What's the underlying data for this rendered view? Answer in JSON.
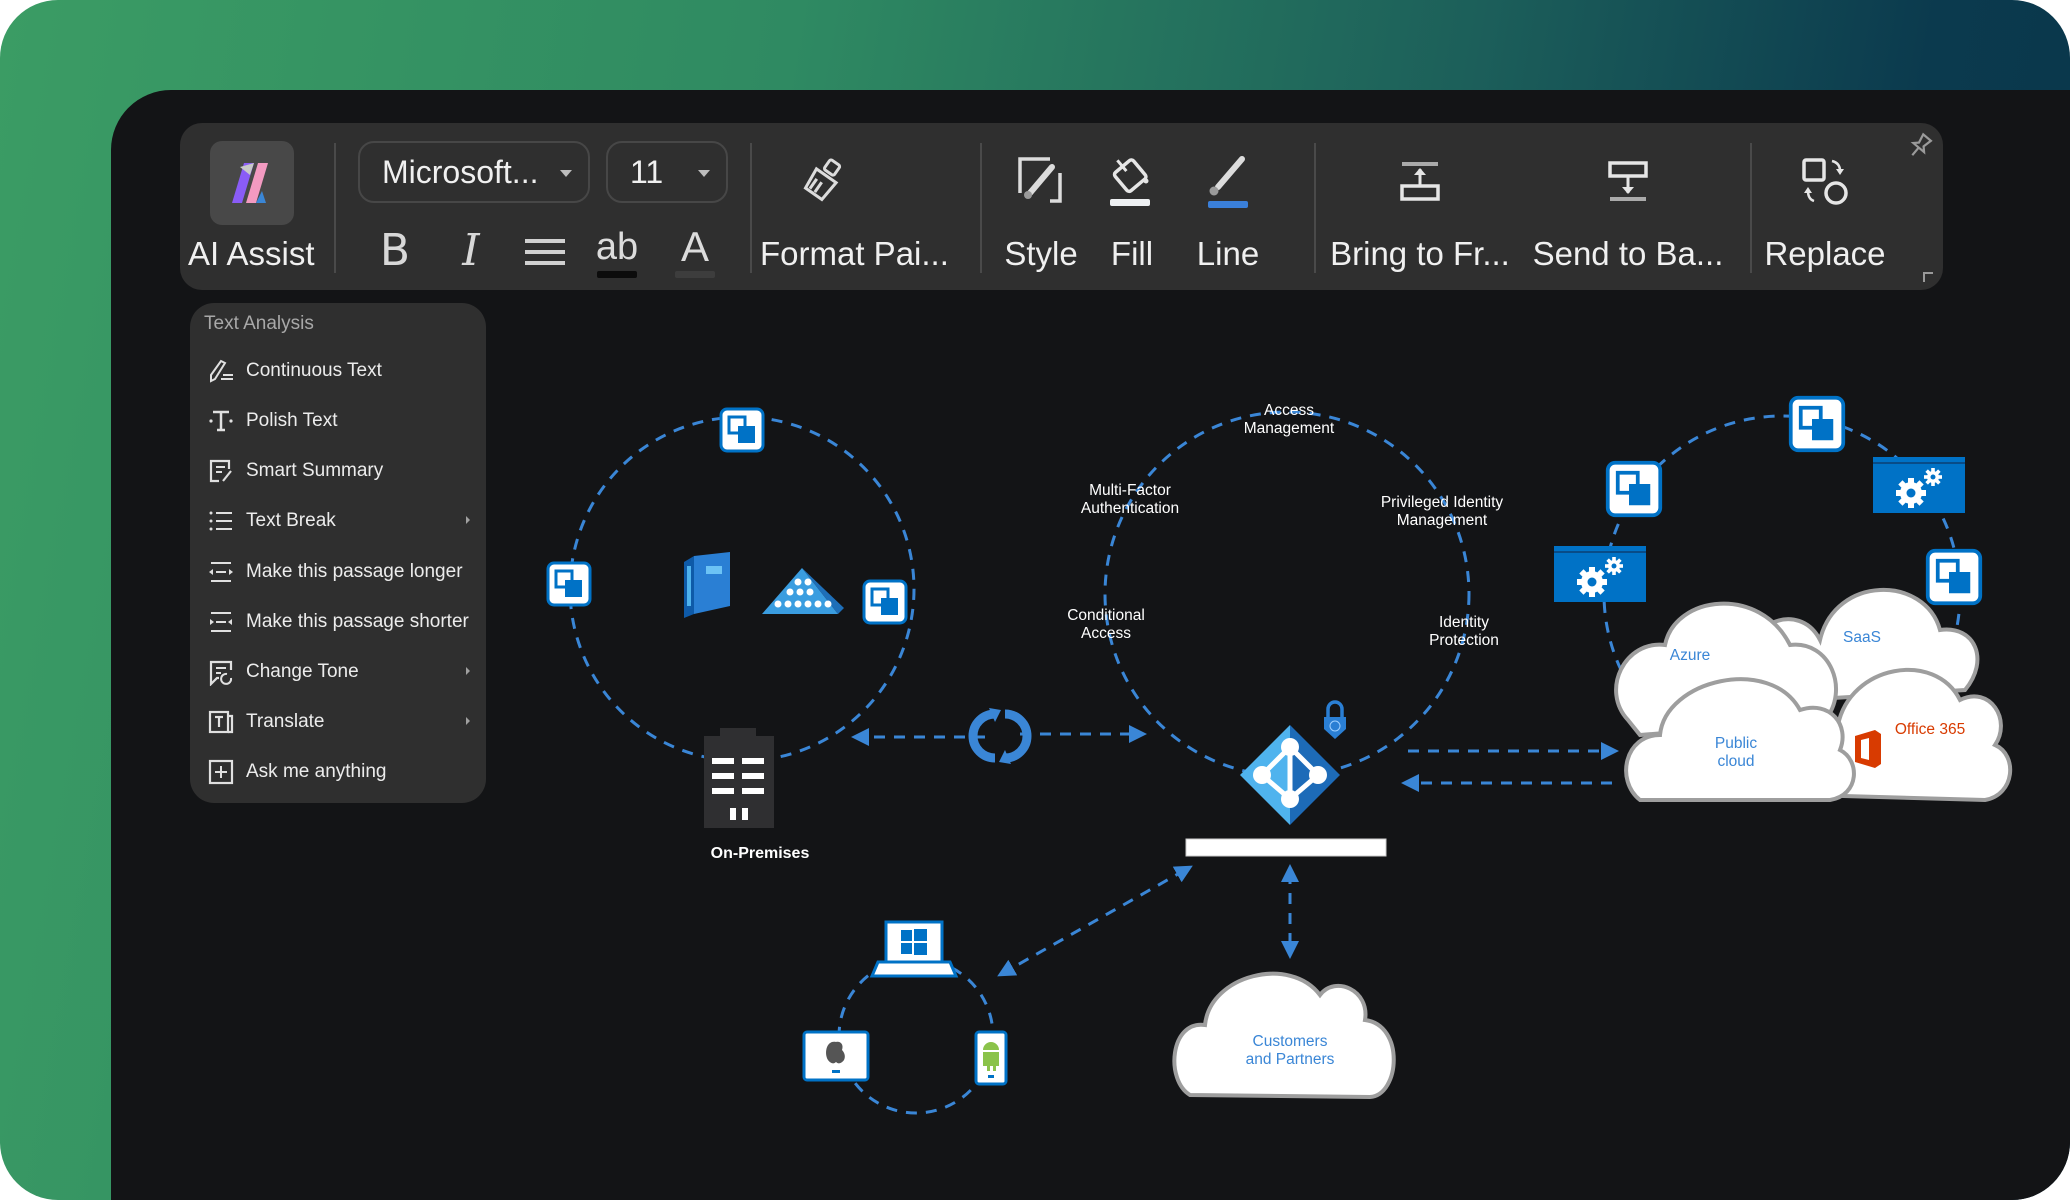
{
  "toolbar": {
    "ai_assist_label": "AI Assist",
    "font_name": "Microsoft...",
    "font_size": "11",
    "bold_label": "B",
    "italic_label": "I",
    "highlight_label": "ab",
    "font_color_label": "A",
    "format_painter_label": "Format Pai...",
    "style_label": "Style",
    "fill_label": "Fill",
    "line_label": "Line",
    "bring_front_label": "Bring to Fr...",
    "send_back_label": "Send to Ba...",
    "replace_label": "Replace",
    "line_color": "#3a7fd9"
  },
  "menu": {
    "title": "Text Analysis",
    "items": [
      {
        "label": "Continuous Text",
        "icon": "pen-lines-icon",
        "submenu": false
      },
      {
        "label": "Polish Text",
        "icon": "text-cursor-icon",
        "submenu": false
      },
      {
        "label": "Smart Summary",
        "icon": "summary-doc-icon",
        "submenu": false
      },
      {
        "label": "Text Break",
        "icon": "list-icon",
        "submenu": true
      },
      {
        "label": "Make this passage longer",
        "icon": "expand-lines-icon",
        "submenu": false
      },
      {
        "label": "Make this passage shorter",
        "icon": "shrink-lines-icon",
        "submenu": false
      },
      {
        "label": "Change Tone",
        "icon": "tone-icon",
        "submenu": true
      },
      {
        "label": "Translate",
        "icon": "translate-icon",
        "submenu": true
      },
      {
        "label": "Ask me anything",
        "icon": "plus-box-icon",
        "submenu": false
      }
    ]
  },
  "diagram": {
    "on_premises_label": "On-Premises",
    "identity_features": {
      "access_management": "Access\nManagement",
      "mfa": "Multi-Factor\nAuthentication",
      "pim": "Privileged Identity\nManagement",
      "conditional_access": "Conditional\nAccess",
      "identity_protection": "Identity\nProtection"
    },
    "clouds": {
      "azure": "Azure",
      "saas": "SaaS",
      "public_cloud": "Public\ncloud",
      "office365": "Office 365",
      "customers": "Customers\nand Partners"
    },
    "colors": {
      "accent_blue": "#3a86d6",
      "azure_blue": "#0072c6",
      "office_red": "#d83b01"
    }
  }
}
